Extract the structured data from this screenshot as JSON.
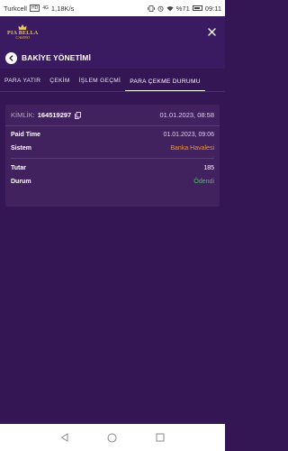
{
  "status_bar": {
    "carrier": "Turkcell",
    "network_badge": "HD",
    "signal": "4G",
    "speed": "1,18K/s",
    "battery": "%71",
    "time": "09:11"
  },
  "brand": {
    "line1": "PIA BELLA",
    "line2": "CASINO",
    "accent_color": "#e8c46a"
  },
  "page": {
    "title": "BAKİYE YÖNETİMİ"
  },
  "tabs": [
    {
      "label": "PARA YATIR"
    },
    {
      "label": "ÇEKİM"
    },
    {
      "label": "İŞLEM GEÇMİ"
    },
    {
      "label": "PARA ÇEKME DURUMU",
      "active": true
    }
  ],
  "transaction": {
    "id_label": "KİMLİK:",
    "id_value": "164519297",
    "header_date": "01.01.2023, 08:58",
    "paid_time_label": "Paid Time",
    "paid_time_value": "01.01.2023, 09:06",
    "system_label": "Sistem",
    "system_value": "Banka Havalesi",
    "amount_label": "Tutar",
    "amount_value": "185",
    "status_label": "Durum",
    "status_value": "Ödendi"
  },
  "colors": {
    "background": "#341655",
    "card": "#42215f",
    "system_value": "#e8953a",
    "status_paid": "#42c15a"
  },
  "icons": {
    "close": "close-icon",
    "back": "back-arrow-icon",
    "copy": "copy-icon",
    "nav_back": "triangle-back-icon",
    "nav_home": "circle-home-icon",
    "nav_recent": "square-recent-icon"
  }
}
